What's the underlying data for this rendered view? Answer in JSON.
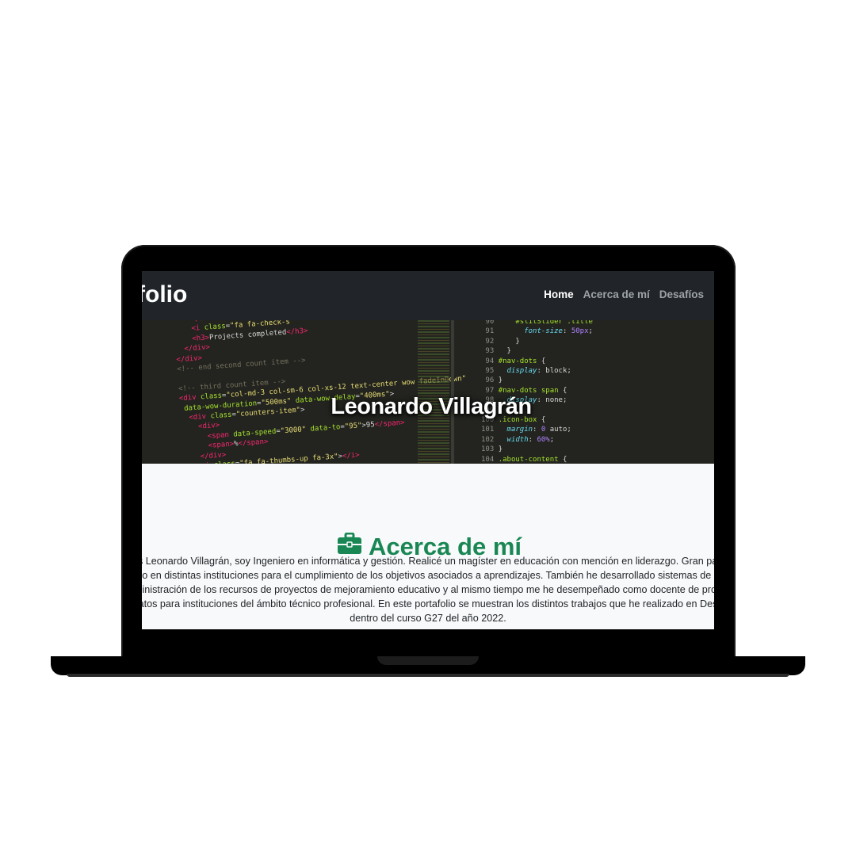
{
  "navbar": {
    "brand": "folio",
    "links": [
      {
        "label": "Home",
        "active": true
      },
      {
        "label": "Acerca de mí",
        "active": false
      },
      {
        "label": "Desafíos",
        "active": false
      }
    ]
  },
  "hero": {
    "title": "Leonardo Villagrán"
  },
  "about": {
    "heading": "Acerca de mí",
    "icon": "briefcase-icon",
    "lines": [
      "es Leonardo Villagrán, soy Ingeniero en informática y gestión. Realicé un magíster en educación con mención en liderazgo. Gran part",
      "ado en distintas instituciones para el cumplimiento de los objetivos asociados a aprendizajes. También he desarrollado sistemas de ge",
      "ministración de los recursos de proyectos de mejoramiento educativo y al mismo tiempo me he desempeñado como docente de prog",
      "datos para instituciones del ámbito técnico profesional. En este portafolio se muestran los distintos trabajos que he realizado en Desa",
      "dentro del curso G27 del año 2022."
    ]
  },
  "colors": {
    "navbar_bg": "#212529",
    "accent_green": "#198754",
    "section_bg": "#f8f9fa"
  }
}
